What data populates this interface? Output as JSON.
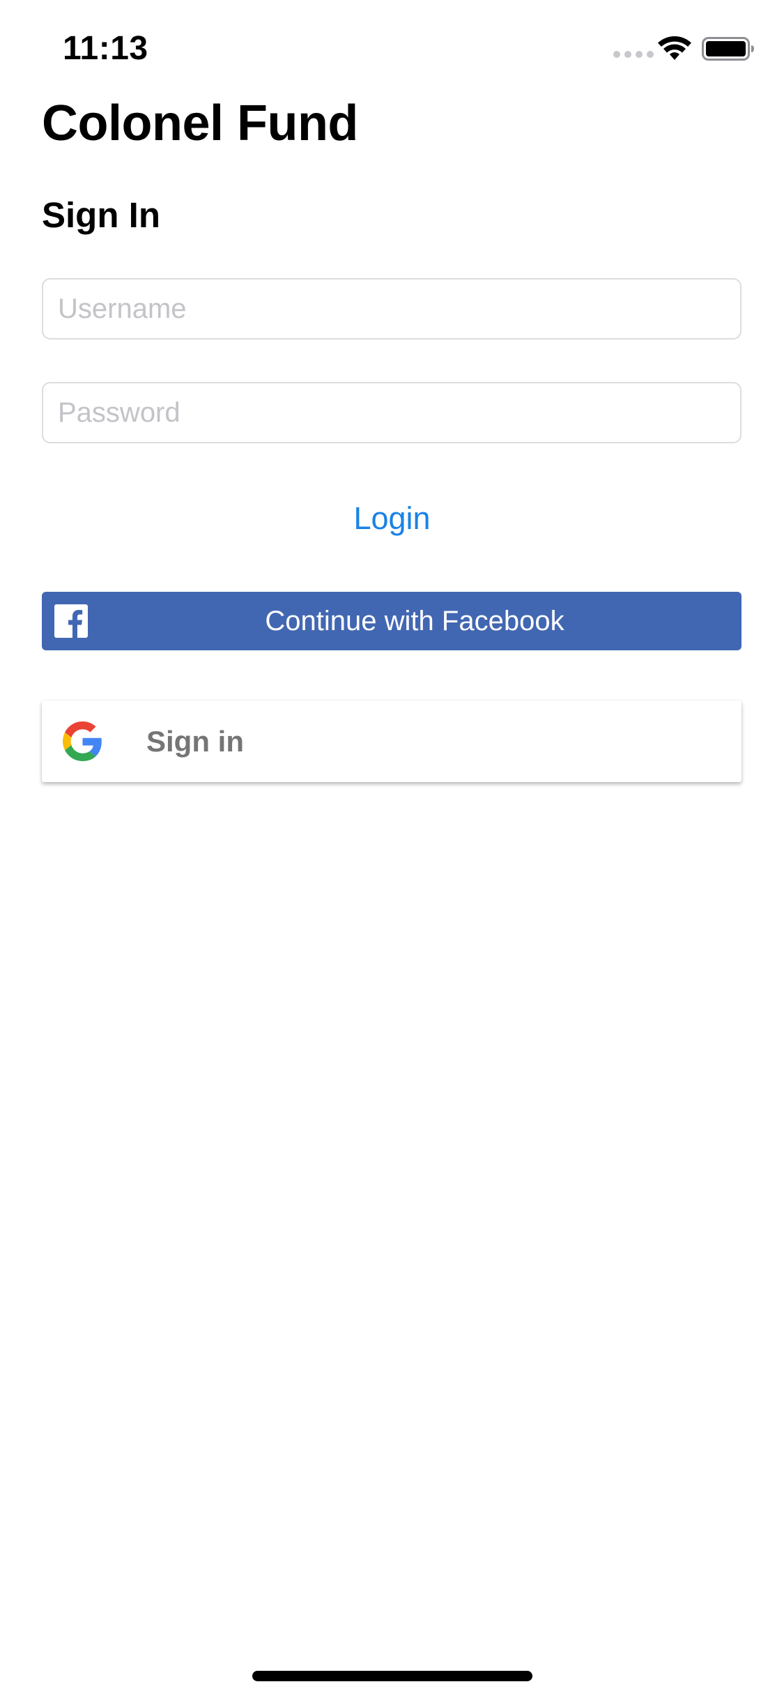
{
  "status_bar": {
    "time": "11:13"
  },
  "app": {
    "title": "Colonel Fund"
  },
  "form": {
    "heading": "Sign In",
    "username_placeholder": "Username",
    "username_value": "",
    "password_placeholder": "Password",
    "password_value": "",
    "login_label": "Login"
  },
  "social": {
    "facebook_label": "Continue with Facebook",
    "facebook_icon": "facebook-f-icon",
    "facebook_color": "#4267B2",
    "google_label": "Sign in",
    "google_icon": "google-g-icon"
  },
  "colors": {
    "link": "#1A82E6",
    "placeholder": "#C3C3C8",
    "field_border": "#DCDCE1"
  }
}
